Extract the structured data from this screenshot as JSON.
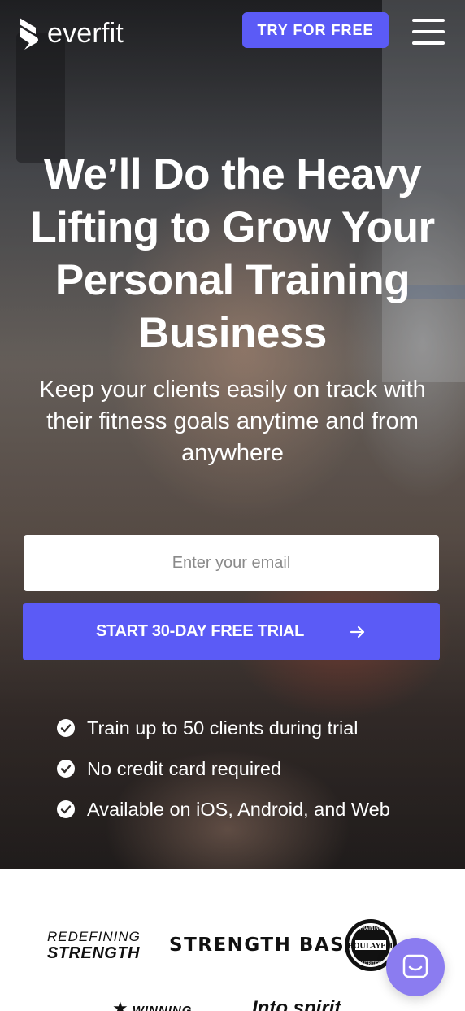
{
  "header": {
    "logo_text": "everfit",
    "try_button": "TRY FOR FREE"
  },
  "hero": {
    "headline": "We’ll Do the Heavy Lifting to Grow Your Personal Training Business",
    "subheadline": "Keep your clients easily on track with their fitness goals anytime and from anywhere",
    "email_placeholder": "Enter your email",
    "cta_label": "START 30-DAY FREE TRIAL",
    "checklist": [
      "Train up to 50 clients during trial",
      "No credit card required",
      "Available on iOS, Android, and Web"
    ]
  },
  "logos": {
    "redefining_line1": "REDEFINING",
    "redefining_line2": "STRENGTH",
    "strength_base": "STRENGTH BASE",
    "boulayfit_top": "TRAINING",
    "boulayfit_name": "BOULAYFIT",
    "boulayfit_bottom": "NUTRITION",
    "winning": "WINNING",
    "intospirit": "Into spirit"
  },
  "colors": {
    "accent": "#5b5bf6",
    "chat": "#8b7cf0"
  },
  "icons": [
    "everfit-logo-icon",
    "hamburger-menu-icon",
    "arrow-right-icon",
    "check-circle-icon",
    "chat-icon"
  ]
}
